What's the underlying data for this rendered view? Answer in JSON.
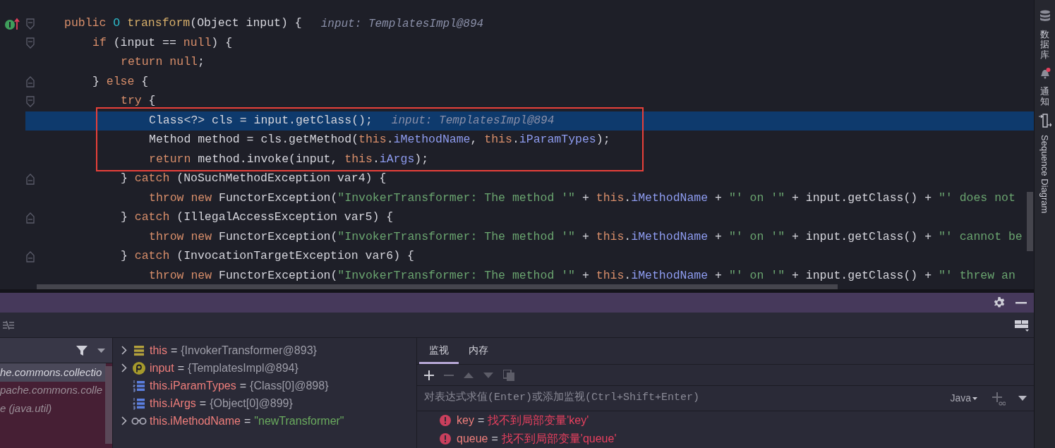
{
  "editor": {
    "lines": [
      {
        "implements": true,
        "closes_block": false,
        "current": false,
        "boxed": false,
        "tokens": [
          {
            "kind": "kw",
            "text": "public"
          },
          {
            "kind": "type",
            "text": " O"
          },
          {
            "kind": "decl",
            "text": " transform"
          },
          {
            "kind": "plain",
            "text": "(Object input) {"
          }
        ],
        "hint": "input: TemplatesImpl@894",
        "children": [
          {
            "implements": false,
            "closes_block": false,
            "current": false,
            "boxed": false,
            "tokens": [
              {
                "kind": "kw",
                "text": "if"
              },
              {
                "kind": "plain",
                "text": " (input == "
              },
              {
                "kind": "kw",
                "text": "null"
              },
              {
                "kind": "plain",
                "text": ") {"
              }
            ],
            "children": [
              {
                "implements": false,
                "current": false,
                "boxed": false,
                "tokens": [
                  {
                    "kind": "kw",
                    "text": "return"
                  },
                  {
                    "kind": "kw",
                    "text": " null"
                  },
                  {
                    "kind": "plain",
                    "text": ";"
                  }
                ]
              }
            ]
          },
          {
            "implements": false,
            "closes_block": true,
            "current": false,
            "boxed": false,
            "tokens": [
              {
                "kind": "plain",
                "text": "} "
              },
              {
                "kind": "kw",
                "text": "else"
              },
              {
                "kind": "plain",
                "text": " {"
              }
            ],
            "children": [
              {
                "implements": false,
                "closes_block": false,
                "current": false,
                "boxed": false,
                "tokens": [
                  {
                    "kind": "kw",
                    "text": "try"
                  },
                  {
                    "kind": "plain",
                    "text": " {"
                  }
                ],
                "children": [
                  {
                    "implements": false,
                    "current": true,
                    "boxed": true,
                    "tokens": [
                      {
                        "kind": "plain",
                        "text": "Class<?> cls = input.getClass();"
                      }
                    ],
                    "hint": "input: TemplatesImpl@894"
                  },
                  {
                    "implements": false,
                    "current": false,
                    "boxed": true,
                    "tokens": [
                      {
                        "kind": "plain",
                        "text": "Method method = cls.getMethod("
                      },
                      {
                        "kind": "kw",
                        "text": "this"
                      },
                      {
                        "kind": "plain",
                        "text": "."
                      },
                      {
                        "kind": "field",
                        "text": "iMethodName"
                      },
                      {
                        "kind": "plain",
                        "text": ", "
                      },
                      {
                        "kind": "kw",
                        "text": "this"
                      },
                      {
                        "kind": "plain",
                        "text": "."
                      },
                      {
                        "kind": "field",
                        "text": "iParamTypes"
                      },
                      {
                        "kind": "plain",
                        "text": ");"
                      }
                    ]
                  },
                  {
                    "implements": false,
                    "current": false,
                    "boxed": true,
                    "tokens": [
                      {
                        "kind": "kw",
                        "text": "return"
                      },
                      {
                        "kind": "plain",
                        "text": " method.invoke(input, "
                      },
                      {
                        "kind": "kw",
                        "text": "this"
                      },
                      {
                        "kind": "plain",
                        "text": "."
                      },
                      {
                        "kind": "field",
                        "text": "iArgs"
                      },
                      {
                        "kind": "plain",
                        "text": ");"
                      }
                    ]
                  }
                ]
              },
              {
                "implements": false,
                "closes_block": true,
                "current": false,
                "boxed": false,
                "tokens": [
                  {
                    "kind": "plain",
                    "text": "} "
                  },
                  {
                    "kind": "kw",
                    "text": "catch"
                  },
                  {
                    "kind": "plain",
                    "text": " (NoSuchMethodException var4) {"
                  }
                ],
                "children": [
                  {
                    "implements": false,
                    "current": false,
                    "boxed": false,
                    "tokens": [
                      {
                        "kind": "kw",
                        "text": "throw"
                      },
                      {
                        "kind": "kw",
                        "text": " new"
                      },
                      {
                        "kind": "plain",
                        "text": " FunctorException("
                      },
                      {
                        "kind": "str",
                        "text": "\"InvokerTransformer: The method '\""
                      },
                      {
                        "kind": "plain",
                        "text": " + "
                      },
                      {
                        "kind": "kw",
                        "text": "this"
                      },
                      {
                        "kind": "plain",
                        "text": "."
                      },
                      {
                        "kind": "field",
                        "text": "iMethodName"
                      },
                      {
                        "kind": "plain",
                        "text": " + "
                      },
                      {
                        "kind": "str",
                        "text": "\"' on '\""
                      },
                      {
                        "kind": "plain",
                        "text": " + input.getClass() + "
                      },
                      {
                        "kind": "str",
                        "text": "\"' does not"
                      }
                    ]
                  }
                ]
              },
              {
                "implements": false,
                "closes_block": true,
                "current": false,
                "boxed": false,
                "tokens": [
                  {
                    "kind": "plain",
                    "text": "} "
                  },
                  {
                    "kind": "kw",
                    "text": "catch"
                  },
                  {
                    "kind": "plain",
                    "text": " (IllegalAccessException var5) {"
                  }
                ],
                "children": [
                  {
                    "implements": false,
                    "current": false,
                    "boxed": false,
                    "tokens": [
                      {
                        "kind": "kw",
                        "text": "throw"
                      },
                      {
                        "kind": "kw",
                        "text": " new"
                      },
                      {
                        "kind": "plain",
                        "text": " FunctorException("
                      },
                      {
                        "kind": "str",
                        "text": "\"InvokerTransformer: The method '\""
                      },
                      {
                        "kind": "plain",
                        "text": " + "
                      },
                      {
                        "kind": "kw",
                        "text": "this"
                      },
                      {
                        "kind": "plain",
                        "text": "."
                      },
                      {
                        "kind": "field",
                        "text": "iMethodName"
                      },
                      {
                        "kind": "plain",
                        "text": " + "
                      },
                      {
                        "kind": "str",
                        "text": "\"' on '\""
                      },
                      {
                        "kind": "plain",
                        "text": " + input.getClass() + "
                      },
                      {
                        "kind": "str",
                        "text": "\"' cannot be"
                      }
                    ]
                  }
                ]
              },
              {
                "implements": false,
                "closes_block": true,
                "current": false,
                "boxed": false,
                "tokens": [
                  {
                    "kind": "plain",
                    "text": "} "
                  },
                  {
                    "kind": "kw",
                    "text": "catch"
                  },
                  {
                    "kind": "plain",
                    "text": " (InvocationTargetException var6) {"
                  }
                ],
                "children": [
                  {
                    "implements": false,
                    "current": false,
                    "boxed": false,
                    "tokens": [
                      {
                        "kind": "kw",
                        "text": "throw"
                      },
                      {
                        "kind": "kw",
                        "text": " new"
                      },
                      {
                        "kind": "plain",
                        "text": " FunctorException("
                      },
                      {
                        "kind": "str",
                        "text": "\"InvokerTransformer: The method '\""
                      },
                      {
                        "kind": "plain",
                        "text": " + "
                      },
                      {
                        "kind": "kw",
                        "text": "this"
                      },
                      {
                        "kind": "plain",
                        "text": "."
                      },
                      {
                        "kind": "field",
                        "text": "iMethodName"
                      },
                      {
                        "kind": "plain",
                        "text": " + "
                      },
                      {
                        "kind": "str",
                        "text": "\"' on '\""
                      },
                      {
                        "kind": "plain",
                        "text": " + input.getClass() + "
                      },
                      {
                        "kind": "str",
                        "text": "\"' threw an"
                      }
                    ]
                  }
                ]
              }
            ]
          }
        ]
      }
    ]
  },
  "side_tools": [
    {
      "kind": "database",
      "label": "数据库"
    },
    {
      "kind": "notifications",
      "label": "通知"
    },
    {
      "kind": "sequence",
      "label": "Sequence Diagram"
    }
  ],
  "frames": [
    {
      "text": "he.commons.collectio",
      "selected": true
    },
    {
      "text": "pache.commons.colle",
      "selected": false
    },
    {
      "text": "e (java.util)",
      "selected": false
    }
  ],
  "variables": [
    {
      "expandable": true,
      "kind": "field",
      "name": "this",
      "separator": "=",
      "value": "{InvokerTransformer@893}",
      "is_string": false
    },
    {
      "expandable": true,
      "kind": "param",
      "name": "input",
      "separator": "=",
      "value": "{TemplatesImpl@894}",
      "is_string": false
    },
    {
      "expandable": false,
      "kind": "array",
      "name": "this.iParamTypes",
      "separator": "=",
      "value": "{Class[0]@898}",
      "is_string": false
    },
    {
      "expandable": false,
      "kind": "array",
      "name": "this.iArgs",
      "separator": "=",
      "value": "{Object[0]@899}",
      "is_string": false
    },
    {
      "expandable": true,
      "kind": "watch",
      "name": "this.iMethodName",
      "separator": "=",
      "value": "\"newTransformer\"",
      "is_string": true
    }
  ],
  "watch_panel": {
    "tabs": [
      {
        "label": "监视",
        "selected": true
      },
      {
        "label": "内存",
        "selected": false
      }
    ],
    "placeholder": "对表达式求值(Enter)或添加监视(Ctrl+Shift+Enter)",
    "language": "Java",
    "watches": [
      {
        "name": "key",
        "separator": "=",
        "message": "找不到局部变量'key'"
      },
      {
        "name": "queue",
        "separator": "=",
        "message": "找不到局部变量'queue'"
      }
    ]
  }
}
